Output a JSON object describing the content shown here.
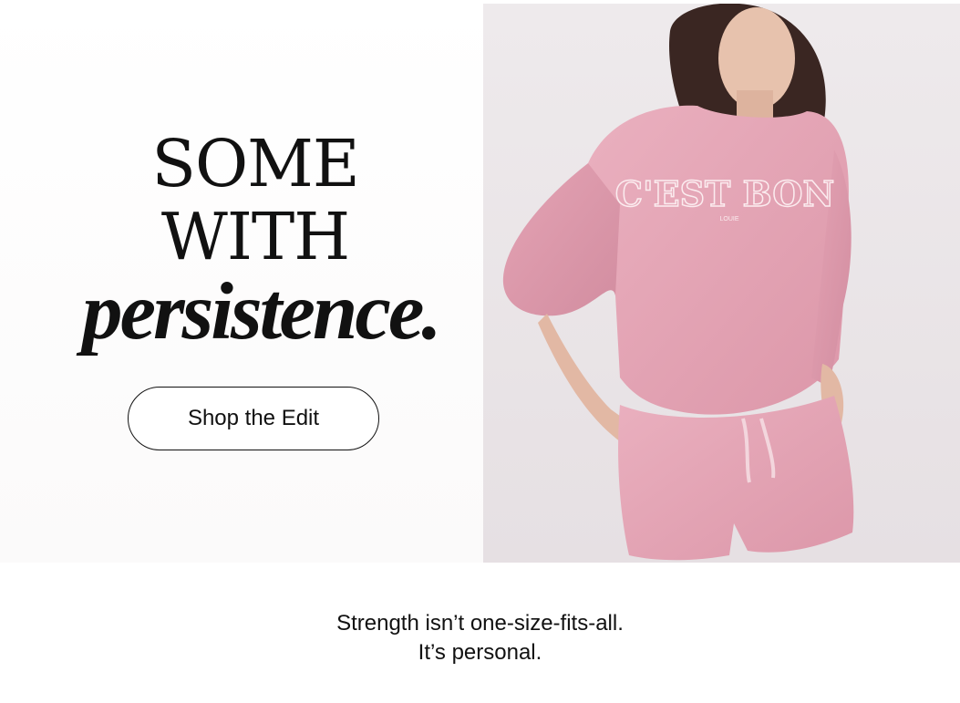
{
  "hero": {
    "headline": {
      "line1": "SOME",
      "line2": "WITH",
      "line3": "persistence."
    },
    "cta_label": "Shop the Edit",
    "photo": {
      "garment_text": "C'EST BON",
      "garment_subtext": "LOUIE"
    }
  },
  "tagline": {
    "line1": "Strength isn’t one-size-fits-all.",
    "line2": "It’s personal."
  },
  "colors": {
    "garment_pink": "#e8a8b8",
    "backdrop": "#ece7ea",
    "text": "#111111"
  }
}
